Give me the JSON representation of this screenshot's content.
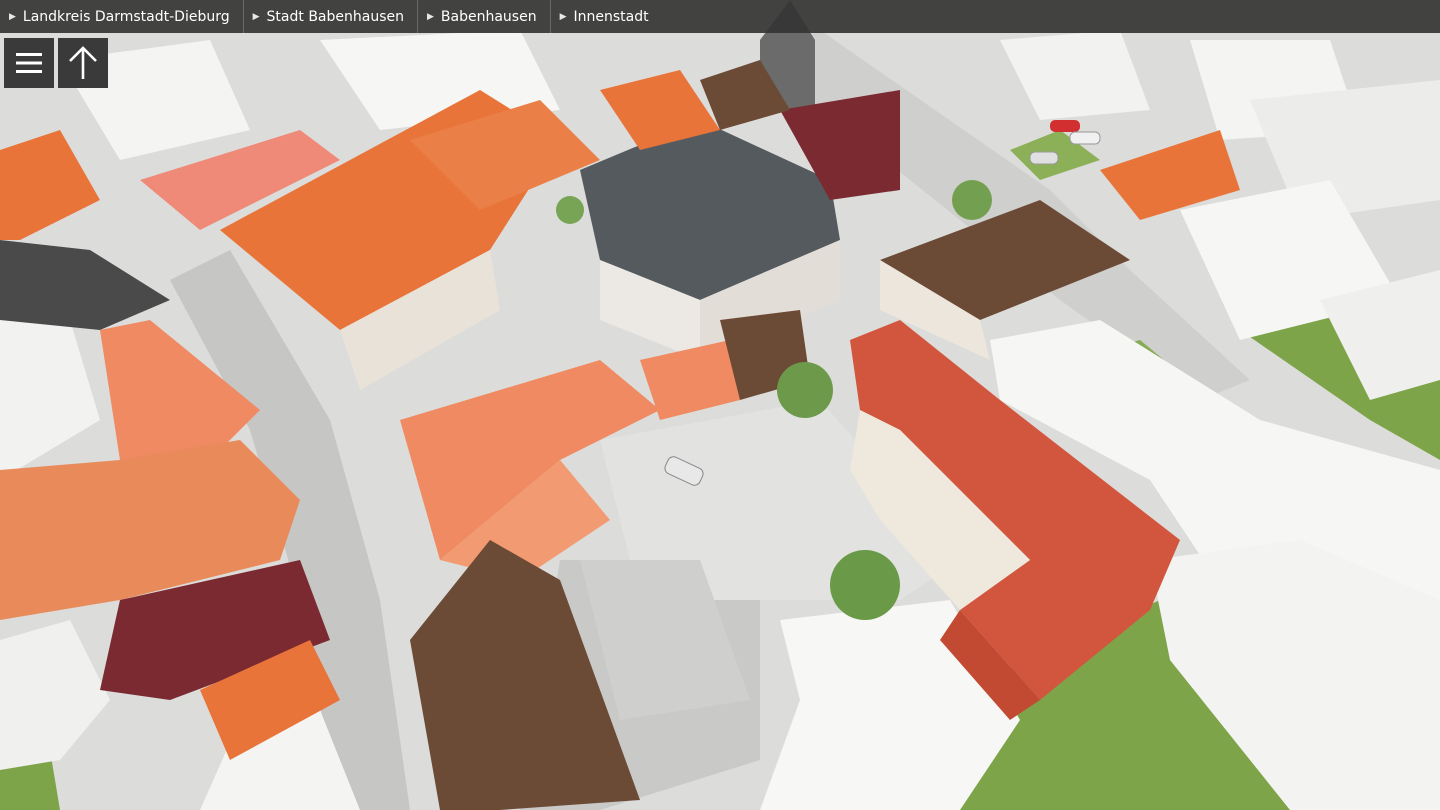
{
  "breadcrumb": {
    "items": [
      {
        "label": "Landkreis Darmstadt-Dieburg"
      },
      {
        "label": "Stadt Babenhausen"
      },
      {
        "label": "Babenhausen"
      },
      {
        "label": "Innenstadt"
      }
    ]
  },
  "toolbar": {
    "menu_icon": "hamburger-menu-icon",
    "north_icon": "arrow-up-icon"
  },
  "colors": {
    "bar_background": "#343434",
    "button_background": "#3a3a3a",
    "roof_orange": "#e8743a",
    "roof_salmon": "#f08a62",
    "roof_grey": "#555a5e",
    "roof_maroon": "#7a2a30",
    "roof_brown": "#6b4a36",
    "ground": "#dcdcda",
    "grass": "#7ea44a",
    "block_white": "#f4f4f2"
  }
}
